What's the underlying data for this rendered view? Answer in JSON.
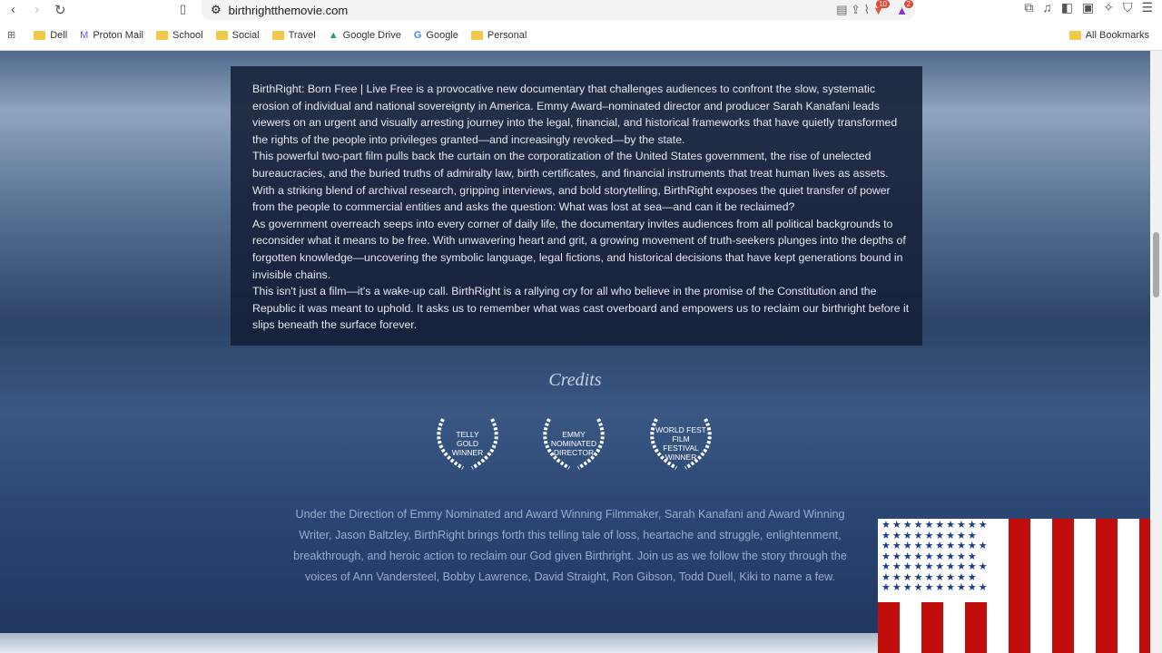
{
  "browser": {
    "url": "birthrightthemovie.com",
    "brave_badge": "10",
    "rewards_badge": "2",
    "bookmarks": [
      "Dell",
      "Proton Mail",
      "School",
      "Social",
      "Travel",
      "Google Drive",
      "Google",
      "Personal"
    ],
    "all_bookmarks": "All Bookmarks"
  },
  "main": {
    "paragraphs": [
      "BirthRight: Born Free | Live Free is a provocative new documentary that challenges audiences to confront the slow, systematic erosion of individual and national sovereignty in America. Emmy Award–nominated director and producer Sarah Kanafani leads viewers on an urgent and visually arresting journey into the legal, financial, and historical frameworks that have quietly transformed the rights of the people into privileges granted—and increasingly revoked—by the state.",
      "This powerful two-part film pulls back the curtain on the corporatization of the United States government, the rise of unelected bureaucracies, and the buried truths of admiralty law, birth certificates, and financial instruments that treat human lives as assets. With a striking blend of archival research, gripping interviews, and bold storytelling, BirthRight exposes the quiet transfer of power from the people to commercial entities and asks the question: What was lost at sea—and can it be reclaimed?",
      "As government overreach seeps into every corner of daily life, the documentary invites audiences from all political backgrounds to reconsider what it means to be free. With unwavering heart and grit, a growing movement of truth-seekers plunges into the depths of forgotten knowledge—uncovering the symbolic language, legal fictions, and historical decisions that have kept generations bound in invisible chains.",
      "This isn't just a film—it's a wake-up call. BirthRight is a rallying cry for all who believe in the promise of the Constitution and the Republic it was meant to uphold. It asks us to remember what was cast overboard and empowers us to reclaim our birthright before it slips beneath the surface forever."
    ],
    "credits_title": "Credits",
    "awards": [
      [
        "TELLY",
        "GOLD",
        "WINNER"
      ],
      [
        "EMMY",
        "NOMINATED",
        "DIRECTOR"
      ],
      [
        "WORLD FEST",
        "FILM",
        "FESTIVAL",
        "WINNER"
      ]
    ],
    "description": "Under the Direction of Emmy Nominated and Award Winning Filmmaker, Sarah Kanafani and Award Winning Writer, Jason Baltzley, BirthRight brings forth this telling tale of loss, heartache and struggle, enlightenment, breakthrough, and heroic action to reclaim our God given Birthright.  Join us as we follow the story through the voices of Ann Vandersteel, Bobby Lawrence, David Straight, Ron Gibson, Todd Duell, Kiki to name a few."
  }
}
